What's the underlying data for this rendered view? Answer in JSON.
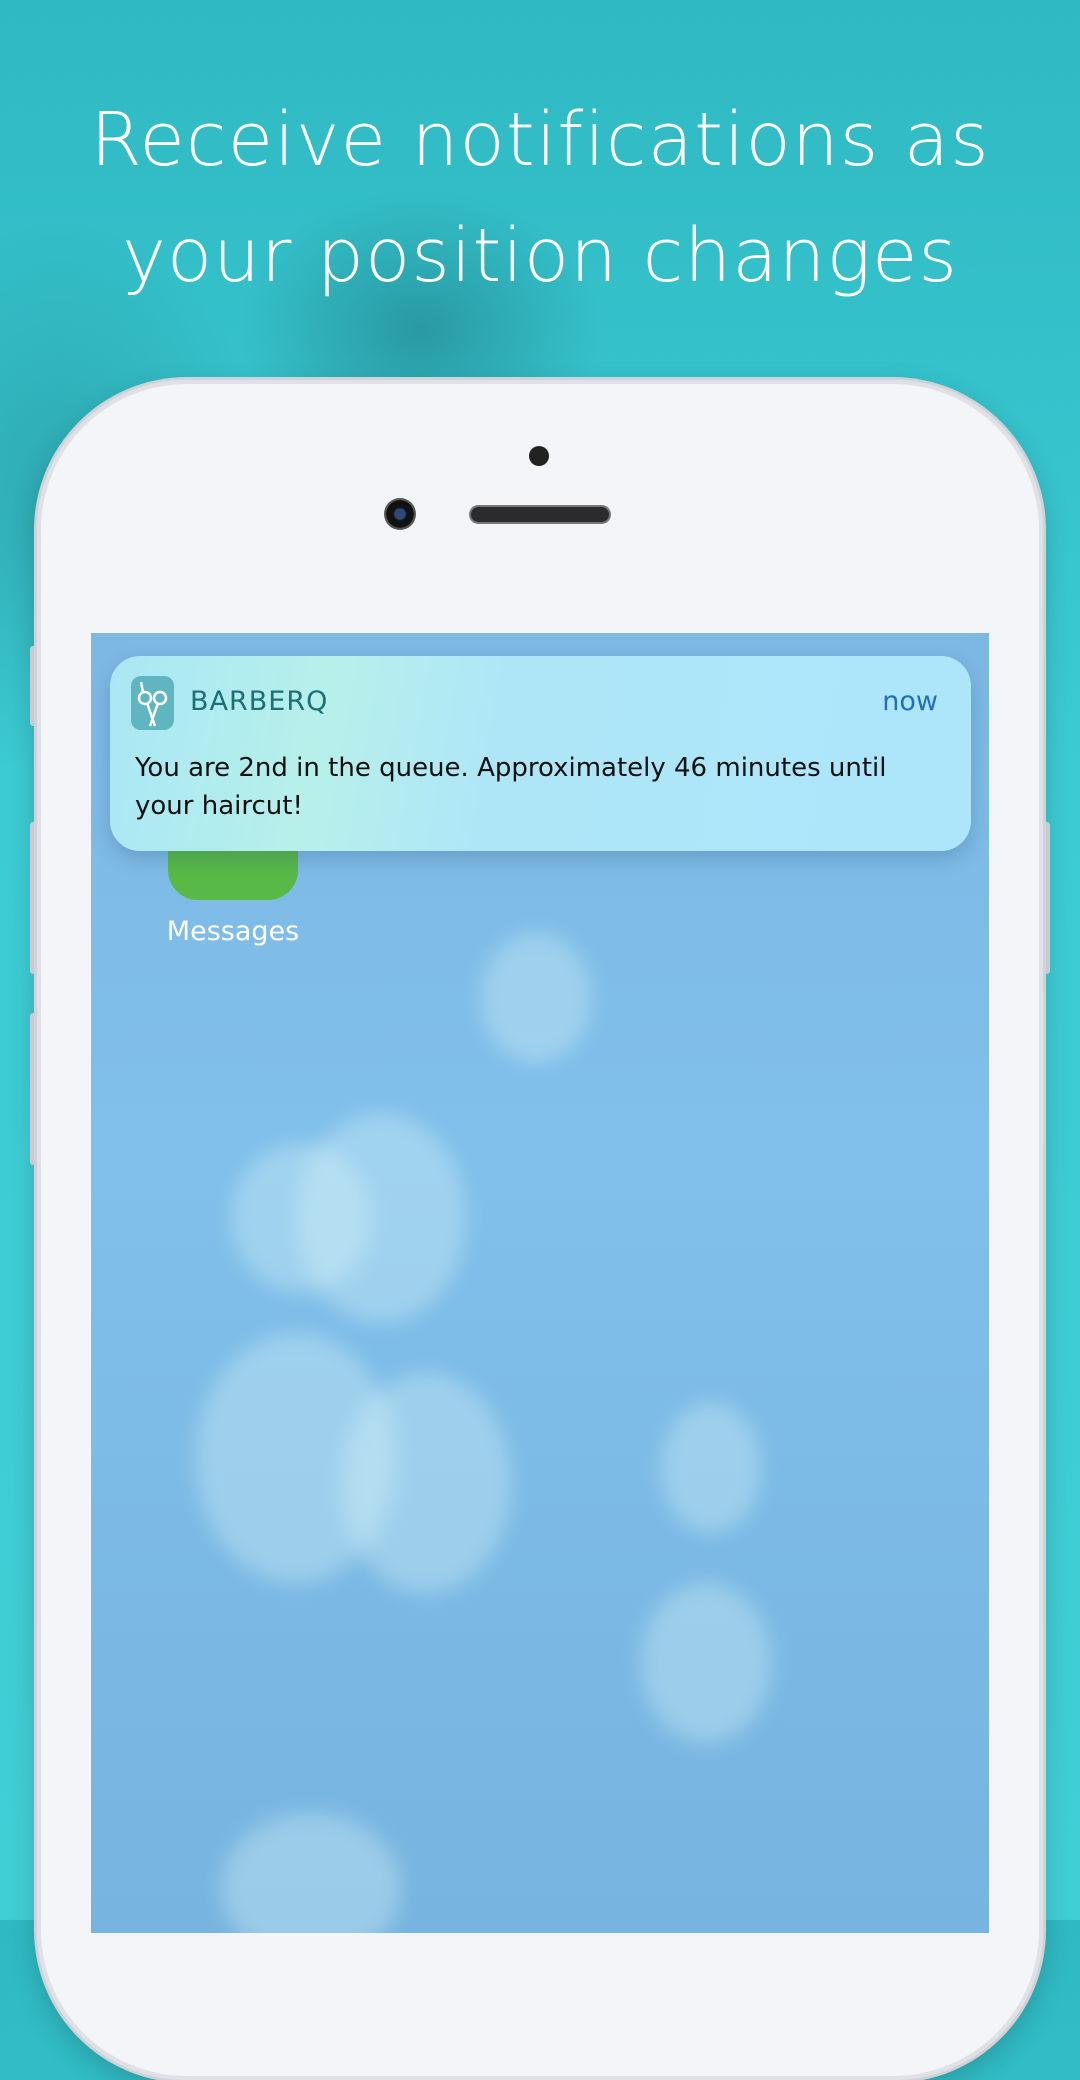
{
  "headline": {
    "line1": "Receive notifications as",
    "line2": "your position changes"
  },
  "home_screen": {
    "app_label": "Messages"
  },
  "notification": {
    "app_name": "BARBERQ",
    "time": "now",
    "message": "You are 2nd in the queue. Approximately 46 minutes until your haircut!",
    "app_icon": "scissors-icon"
  },
  "colors": {
    "background": "#3ccbd3",
    "screen": "#80c0ea",
    "notification": "#ade5fb",
    "app_name": "#1c6f76",
    "time": "#1f6fbf"
  }
}
